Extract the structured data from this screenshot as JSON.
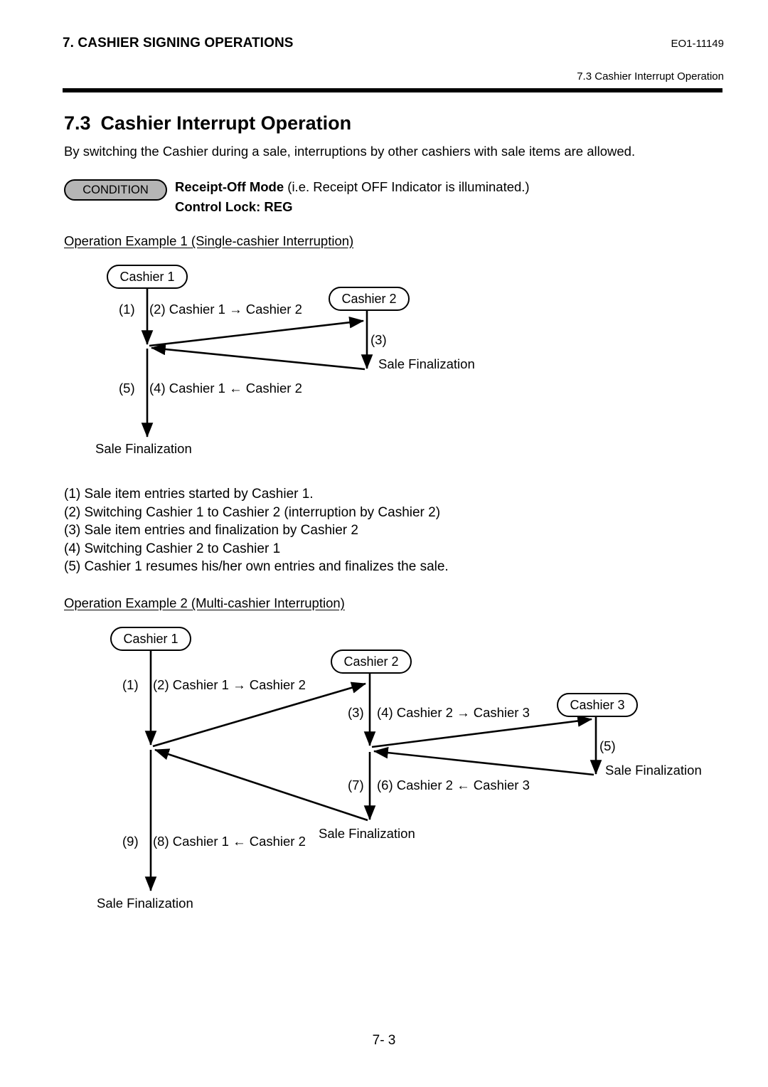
{
  "header": {
    "chapter_title": "7. CASHIER SIGNING OPERATIONS",
    "doc_code": "EO1-11149",
    "section_ref": "7.3 Cashier Interrupt Operation"
  },
  "section": {
    "number": "7.3",
    "title": "Cashier Interrupt Operation",
    "intro": "By switching the Cashier during a sale, interruptions by other cashiers with sale items are allowed."
  },
  "condition": {
    "badge_label": "CONDITION",
    "line1_bold": "Receipt-Off Mode",
    "line1_rest": " (i.e. Receipt OFF Indicator is illuminated.)",
    "line2": "Control Lock: REG"
  },
  "example1": {
    "caption": "Operation Example 1 (Single-cashier Interruption)",
    "nodes": {
      "cashier1": "Cashier 1",
      "cashier2": "Cashier 2"
    },
    "labels": {
      "step1_marker": "(1)",
      "step2_text": "(2) Cashier 1 → Cashier 2",
      "step3_marker": "(3)",
      "step3_finalization": "Sale Finalization",
      "step5_marker": "(5)",
      "step4_text": "(4) Cashier 1 ← Cashier 2",
      "final_finalization": "Sale Finalization"
    }
  },
  "steps": [
    "(1) Sale item entries started by Cashier 1.",
    "(2) Switching Cashier 1 to Cashier 2 (interruption by Cashier 2)",
    "(3) Sale item entries and finalization by Cashier 2",
    "(4) Switching Cashier 2 to Cashier 1",
    "(5) Cashier 1 resumes his/her own entries and finalizes the sale."
  ],
  "example2": {
    "caption": "Operation Example 2 (Multi-cashier Interruption)",
    "nodes": {
      "cashier1": "Cashier 1",
      "cashier2": "Cashier 2",
      "cashier3": "Cashier 3"
    },
    "labels": {
      "step1_marker": "(1)",
      "step2_text": "(2) Cashier 1 → Cashier 2",
      "step3_marker": "(3)",
      "step4_text": "(4) Cashier 2 → Cashier 3",
      "step5_marker": "(5)",
      "step5_finalization": "Sale Finalization",
      "step7_marker": "(7)",
      "step6_text": "(6) Cashier 2 ← Cashier 3",
      "step9_marker": "(9)",
      "step8_text": "(8) Cashier 1 ← Cashier 2",
      "mid_finalization": "Sale Finalization",
      "final_finalization": "Sale Finalization"
    }
  },
  "footer": {
    "page_number": "7- 3"
  }
}
